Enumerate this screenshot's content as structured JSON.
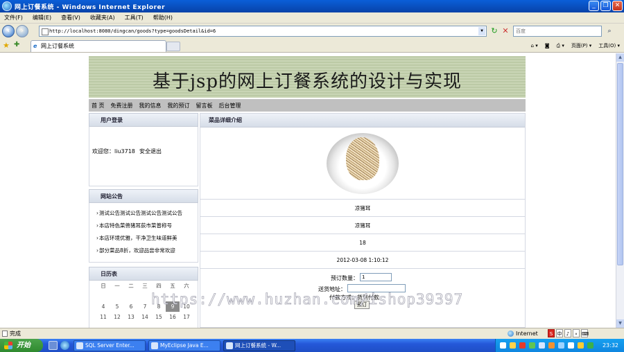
{
  "window": {
    "title": "网上订餐系统 - Windows Internet Explorer",
    "min_glyph": "_",
    "max_glyph": "❐",
    "close_glyph": "✕"
  },
  "menu": [
    "文件(F)",
    "编辑(E)",
    "查看(V)",
    "收藏夹(A)",
    "工具(T)",
    "帮助(H)"
  ],
  "address_bar": {
    "url": "http://localhost:8080/dingcan/goods?type=goodsDetail&id=6",
    "search_placeholder": "百度"
  },
  "icons": {
    "back": "back-arrow-icon",
    "forward": "forward-arrow-icon",
    "refresh": "refresh-icon",
    "stop": "stop-icon",
    "search": "search-magnifier-icon",
    "favorites": "favorites-star-icon",
    "add_favorite": "add-favorite-icon"
  },
  "tab": {
    "label": "网上订餐系统"
  },
  "toolbar_right": [
    "页面(P) ▾",
    "工具(O) ▾"
  ],
  "site": {
    "banner_title": "基于jsp的网上订餐系统的设计与实现",
    "nav": [
      "首 页",
      "免费注册",
      "我的信息",
      "我的预订",
      "留言板",
      "后台管理"
    ],
    "login": {
      "heading": "用户登录",
      "welcome": "欢迎您：liu3718",
      "logout": "安全退出"
    },
    "notice": {
      "heading": "网站公告",
      "items": [
        "测试公告测试公告测试公告测试公告",
        "本店特色菜兽猪耳荻市菜普称号",
        "本店环境优雅，干净卫生味道鲜美",
        "部分菜品8折，欢迎品尝非常欢迎"
      ]
    },
    "calendar": {
      "heading": "日历表",
      "weekdays": [
        "日",
        "一",
        "二",
        "三",
        "四",
        "五",
        "六"
      ],
      "rows": [
        [
          "",
          "",
          "",
          "",
          "",
          "",
          ""
        ],
        [
          "4",
          "5",
          "6",
          "7",
          "8",
          "9",
          "10"
        ],
        [
          "11",
          "12",
          "13",
          "14",
          "15",
          "16",
          "17"
        ]
      ],
      "today": "9"
    },
    "detail": {
      "heading": "菜品详细介绍",
      "name": "凉猪耳",
      "description": "凉猪耳",
      "price": "18",
      "date": "2012-03-08 1:10:12",
      "qty_label": "预订数量：",
      "qty_value": "1",
      "address_label": "送货地址：",
      "pay_label": "付款方式：货到付款",
      "order_button": "预订"
    }
  },
  "watermark": "https://www.huzhan.com/ishop39397",
  "status": {
    "text": "完成",
    "zone": "Internet",
    "ime": [
      "S",
      "中",
      "♪",
      "∘",
      "⌨"
    ]
  },
  "taskbar": {
    "start": "开始",
    "tasks": [
      "SQL Server Enter...",
      "MyEclipse Java E...",
      "网上订餐系统 - W..."
    ],
    "clock": "23:32"
  }
}
